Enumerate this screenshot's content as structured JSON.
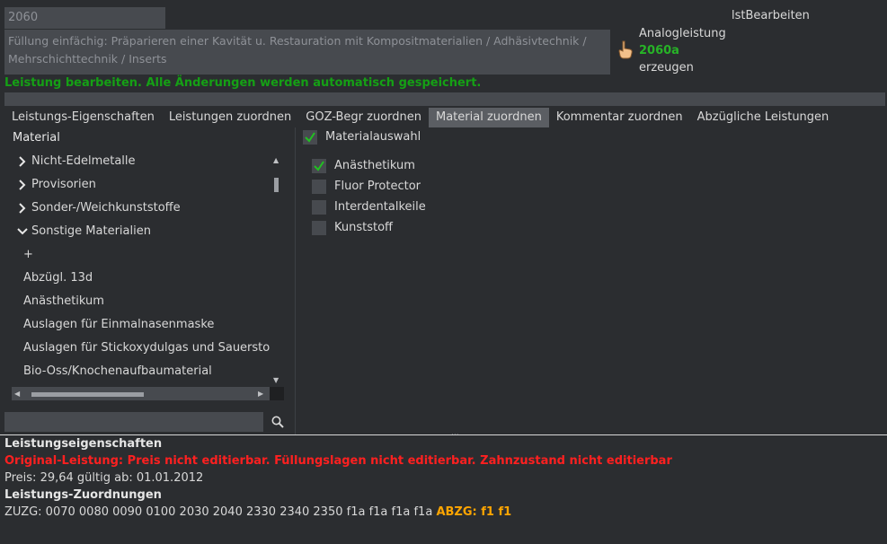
{
  "header": {
    "code": "2060",
    "description": "Füllung einfächig: Präparieren einer Kavität u. Restauration mit Kompositmaterialien / Adhäsivtechnik / Mehrschichttechnik / Inserts",
    "analog_prefix": "Analogleistung",
    "analog_code": "2060a",
    "analog_suffix": "erzeugen",
    "list_label": "lstBearbeiten",
    "status": "Leistung bearbeiten. Alle Änderungen werden automatisch gespeichert."
  },
  "tabs": [
    {
      "label": "Leistungs-Eigenschaften"
    },
    {
      "label": "Leistungen zuordnen"
    },
    {
      "label": "GOZ-Begr zuordnen"
    },
    {
      "label": "Material zuordnen",
      "active": true
    },
    {
      "label": "Kommentar zuordnen"
    },
    {
      "label": "Abzügliche Leistungen"
    }
  ],
  "material_panel": {
    "title": "Material",
    "tree": [
      {
        "label": "Nicht-Edelmetalle",
        "type": "group",
        "expanded": false
      },
      {
        "label": "Provisorien",
        "type": "group",
        "expanded": false
      },
      {
        "label": "Sonder-/Weichkunststoffe",
        "type": "group",
        "expanded": false
      },
      {
        "label": "Sonstige Materialien",
        "type": "group",
        "expanded": true
      },
      {
        "label": "+",
        "type": "leaf"
      },
      {
        "label": "Abzügl. 13d",
        "type": "leaf"
      },
      {
        "label": "Anästhetikum",
        "type": "leaf"
      },
      {
        "label": "Auslagen für Einmalnasenmaske",
        "type": "leaf"
      },
      {
        "label": "Auslagen für Stickoxydulgas und Sauerstoff",
        "type": "leaf"
      },
      {
        "label": "Bio-Oss/Knochenaufbaumaterial",
        "type": "leaf"
      }
    ],
    "search_value": ""
  },
  "selection": {
    "header_label": "Materialauswahl",
    "header_checked": true,
    "items": [
      {
        "label": "Anästhetikum",
        "checked": true
      },
      {
        "label": "Fluor Protector",
        "checked": false
      },
      {
        "label": "Interdentalkeile",
        "checked": false
      },
      {
        "label": "Kunststoff",
        "checked": false
      }
    ]
  },
  "info": {
    "props_title": "Leistungseigenschaften",
    "warning": "Original-Leistung: Preis nicht editierbar. Füllungslagen nicht editierbar. Zahnzustand nicht editierbar",
    "price": "Preis: 29,64 gültig ab: 01.01.2012",
    "assign_title": "Leistungs-Zuordnungen",
    "zuzg": "ZUZG: 0070 0080 0090 0100 2030 2040 2330 2340 2350 f1a f1a f1a f1a",
    "abzg": "ABZG: f1 f1"
  },
  "colors": {
    "background": "#2b2d30",
    "field": "#474a4f",
    "status_green": "#15a015",
    "warning_red": "#ff2020",
    "abzg_orange": "#ffa500",
    "check_green": "#22c022"
  },
  "icons": {
    "analog": "pointing-hand-icon",
    "search": "magnifier-icon",
    "check": "checkmark-icon",
    "expand": "chevron-right-icon",
    "collapse": "chevron-down-icon"
  }
}
